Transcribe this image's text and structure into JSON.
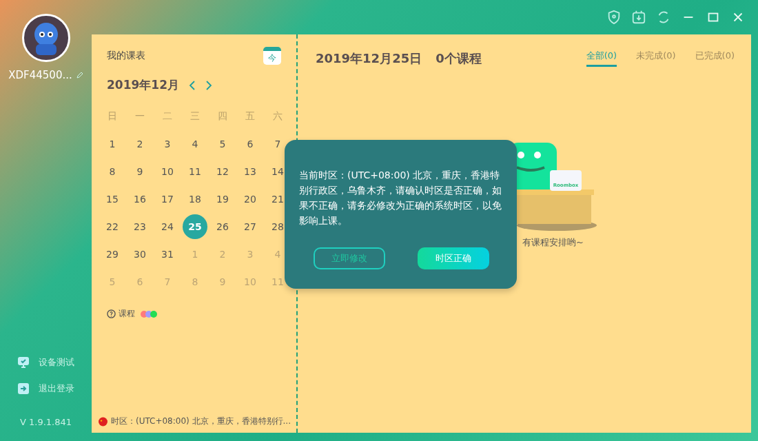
{
  "sidebar": {
    "username": "XDF44500...",
    "items": [
      {
        "kind": "device",
        "label": "设备测试"
      },
      {
        "kind": "logout",
        "label": "退出登录"
      }
    ],
    "version": "V 1.9.1.841"
  },
  "calendar": {
    "title": "我的课表",
    "today_button": "今",
    "month": "2019年12月",
    "weekdays": [
      "日",
      "一",
      "二",
      "三",
      "四",
      "五",
      "六"
    ],
    "days": [
      {
        "label": "1",
        "other_month": false,
        "selected": false
      },
      {
        "label": "2",
        "other_month": false,
        "selected": false
      },
      {
        "label": "3",
        "other_month": false,
        "selected": false
      },
      {
        "label": "4",
        "other_month": false,
        "selected": false
      },
      {
        "label": "5",
        "other_month": false,
        "selected": false
      },
      {
        "label": "6",
        "other_month": false,
        "selected": false
      },
      {
        "label": "7",
        "other_month": false,
        "selected": false
      },
      {
        "label": "8",
        "other_month": false,
        "selected": false
      },
      {
        "label": "9",
        "other_month": false,
        "selected": false
      },
      {
        "label": "10",
        "other_month": false,
        "selected": false
      },
      {
        "label": "11",
        "other_month": false,
        "selected": false
      },
      {
        "label": "12",
        "other_month": false,
        "selected": false
      },
      {
        "label": "13",
        "other_month": false,
        "selected": false
      },
      {
        "label": "14",
        "other_month": false,
        "selected": false
      },
      {
        "label": "15",
        "other_month": false,
        "selected": false
      },
      {
        "label": "16",
        "other_month": false,
        "selected": false
      },
      {
        "label": "17",
        "other_month": false,
        "selected": false
      },
      {
        "label": "18",
        "other_month": false,
        "selected": false
      },
      {
        "label": "19",
        "other_month": false,
        "selected": false
      },
      {
        "label": "20",
        "other_month": false,
        "selected": false
      },
      {
        "label": "21",
        "other_month": false,
        "selected": false
      },
      {
        "label": "22",
        "other_month": false,
        "selected": false
      },
      {
        "label": "23",
        "other_month": false,
        "selected": false
      },
      {
        "label": "24",
        "other_month": false,
        "selected": false
      },
      {
        "label": "25",
        "other_month": false,
        "selected": true
      },
      {
        "label": "26",
        "other_month": false,
        "selected": false
      },
      {
        "label": "27",
        "other_month": false,
        "selected": false
      },
      {
        "label": "28",
        "other_month": false,
        "selected": false
      },
      {
        "label": "29",
        "other_month": false,
        "selected": false
      },
      {
        "label": "30",
        "other_month": false,
        "selected": false
      },
      {
        "label": "31",
        "other_month": false,
        "selected": false
      },
      {
        "label": "1",
        "other_month": true,
        "selected": false
      },
      {
        "label": "2",
        "other_month": true,
        "selected": false
      },
      {
        "label": "3",
        "other_month": true,
        "selected": false
      },
      {
        "label": "4",
        "other_month": true,
        "selected": false
      },
      {
        "label": "5",
        "other_month": true,
        "selected": false
      },
      {
        "label": "6",
        "other_month": true,
        "selected": false
      },
      {
        "label": "7",
        "other_month": true,
        "selected": false
      },
      {
        "label": "8",
        "other_month": true,
        "selected": false
      },
      {
        "label": "9",
        "other_month": true,
        "selected": false
      },
      {
        "label": "10",
        "other_month": true,
        "selected": false
      },
      {
        "label": "11",
        "other_month": true,
        "selected": false
      }
    ],
    "legend": {
      "label": "课程",
      "dots": [
        {
          "color": "#ff7b7b"
        },
        {
          "color": "#a29bfe"
        },
        {
          "color": "#22dd55"
        }
      ]
    },
    "timezone": "时区：(UTC+08:00) 北京，重庆，香港特别行..."
  },
  "schedule": {
    "date": "2019年12月25日",
    "count": "0个课程",
    "tabs": [
      {
        "label": "全部(0)",
        "selected": true
      },
      {
        "label": "未完成(0)",
        "selected": false
      },
      {
        "label": "已完成(0)",
        "selected": false
      }
    ],
    "sign_text": "Roombox",
    "empty_message": "有课程安排哟~"
  },
  "dialog": {
    "message": "当前时区：(UTC+08:00) 北京，重庆，香港特别行政区，乌鲁木齐，请确认时区是否正确，如果不正确，请务必修改为正确的系统时区，以免影响上课。",
    "buttons": [
      {
        "kind": "secondary",
        "label": "立即修改"
      },
      {
        "kind": "primary",
        "label": "时区正确"
      }
    ]
  }
}
